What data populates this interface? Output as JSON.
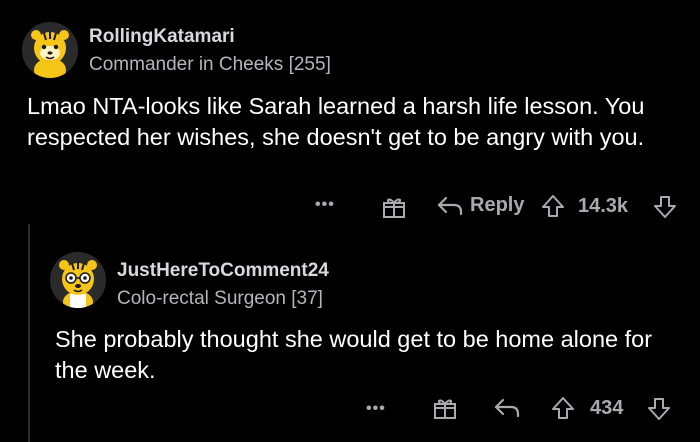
{
  "comments": [
    {
      "username": "RollingKatamari",
      "flair": "Commander in Cheeks [255]",
      "body": "Lmao NTA-looks like Sarah learned a harsh life lesson. You respected her wishes, she doesn't get to be angry with you.",
      "actions": {
        "more": "•••",
        "reply": "Reply",
        "votes": "14.3k"
      }
    },
    {
      "username": "JustHereToComment24",
      "flair": "Colo-rectal Surgeon [37]",
      "body": "She probably thought she would get to be home alone for the week.",
      "actions": {
        "more": "•••",
        "votes": "434"
      }
    }
  ],
  "icons": {
    "avatar": "snoo-avatar-icon",
    "award": "gift-award-icon",
    "reply": "reply-arrow-icon",
    "upvote": "upvote-arrow-icon",
    "downvote": "downvote-arrow-icon"
  },
  "colors": {
    "background": "#000000",
    "text": "#ffffff",
    "muted": "#a8abad",
    "avatar_yellow": "#f5c518",
    "thread_line": "#343536"
  }
}
